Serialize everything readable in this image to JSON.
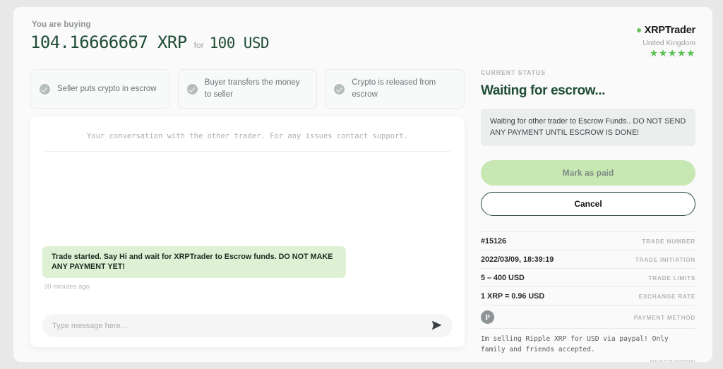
{
  "header": {
    "buying_label": "You are buying",
    "amount_crypto": "104.16666667 XRP",
    "for_word": "for",
    "amount_fiat": "100 USD",
    "brand_name": "XRPTrader",
    "brand_country": "United Kingdom",
    "stars": "★★★★★",
    "brand_dot_color": "#66c45e",
    "star_color": "#5cc055"
  },
  "steps": [
    {
      "label": "Seller puts crypto in escrow",
      "icon": "check-circle-icon"
    },
    {
      "label": "Buyer transfers the money to seller",
      "icon": "check-circle-icon"
    },
    {
      "label": "Crypto is released from escrow",
      "icon": "check-circle-icon"
    }
  ],
  "chat": {
    "notice": "Your conversation with the other trader. For any issues contact support.",
    "messages": [
      {
        "text": "Trade started. Say Hi and wait for XRPTrader to Escrow funds. DO NOT MAKE ANY PAYMENT YET!",
        "time": "30 minutes ago",
        "bubble_color": "#dff1d4"
      }
    ],
    "input_placeholder": "Type message here...",
    "input_value": "",
    "send_icon": "send-paper-plane-icon"
  },
  "status": {
    "label": "CURRENT STATUS",
    "title": "Waiting for escrow...",
    "message": "Waiting for other trader to Escrow Funds.. DO NOT SEND ANY PAYMENT UNTIL ESCROW IS DONE!",
    "title_color": "#1f4d36"
  },
  "actions": {
    "primary_label": "Mark as paid",
    "primary_color": "#c8e8b3",
    "secondary_label": "Cancel"
  },
  "details": [
    {
      "value": "#15126",
      "key": "TRADE NUMBER"
    },
    {
      "value": "2022/03/09, 18:39:19",
      "key": "TRADE INITIATION"
    },
    {
      "value": "5 – 400 USD",
      "key": "TRADE LIMITS"
    },
    {
      "value": "1 XRP = 0.96 USD",
      "key": "EXCHANGE RATE"
    }
  ],
  "payment_method": {
    "key": "PAYMENT METHOD",
    "icon": "paypal-icon",
    "icon_glyph": "P"
  },
  "description": {
    "text": "Im selling Ripple XRP for USD via paypal! Only family and friends accepted.",
    "key": "DESCRIPTION"
  }
}
